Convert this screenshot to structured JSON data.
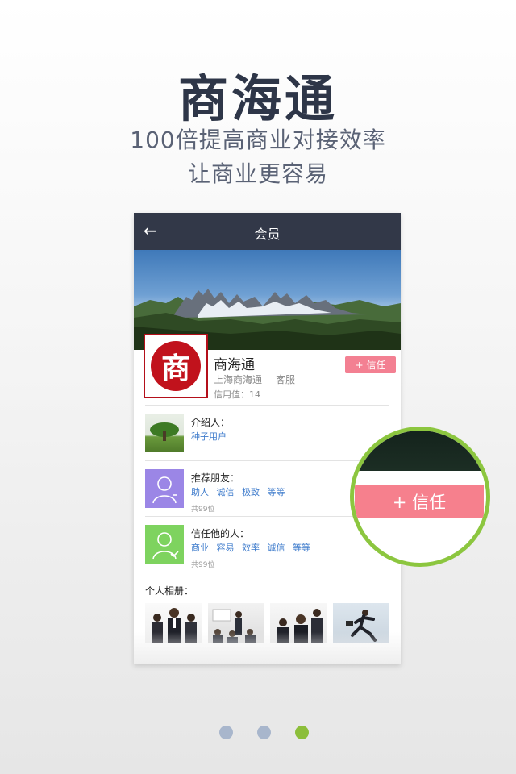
{
  "header": {
    "title": "商海通",
    "subtitle_line1": "100倍提高商业对接效率",
    "subtitle_line2": "让商业更容易"
  },
  "phone": {
    "navbar": {
      "back_icon": "←",
      "title": "会员"
    },
    "profile": {
      "avatar_glyph": "商",
      "name": "商海通",
      "company": "上海商海通",
      "role": "客服",
      "credit": "信用值：14",
      "trust_button": "+ 信任"
    },
    "introducer": {
      "label": "介绍人：",
      "value": "种子用户"
    },
    "recommended": {
      "label": "推荐朋友：",
      "tags": [
        "助人",
        "诚信",
        "极致",
        "等等"
      ],
      "count": "共99位"
    },
    "trusted_by": {
      "label": "信任他的人：",
      "tags": [
        "商业",
        "容易",
        "效率",
        "诚信",
        "等等"
      ],
      "count": "共99位"
    },
    "album": {
      "label": "个人相册："
    }
  },
  "zoom": {
    "trust_button": "+ 信任"
  },
  "pagination": {
    "total": 3,
    "active_index": 2
  },
  "colors": {
    "navbar": "#323848",
    "trust_pink": "#f38092",
    "accent_green": "#8cc63f",
    "link_blue": "#3f7ccc",
    "dot_inactive": "#a8b6cc"
  }
}
